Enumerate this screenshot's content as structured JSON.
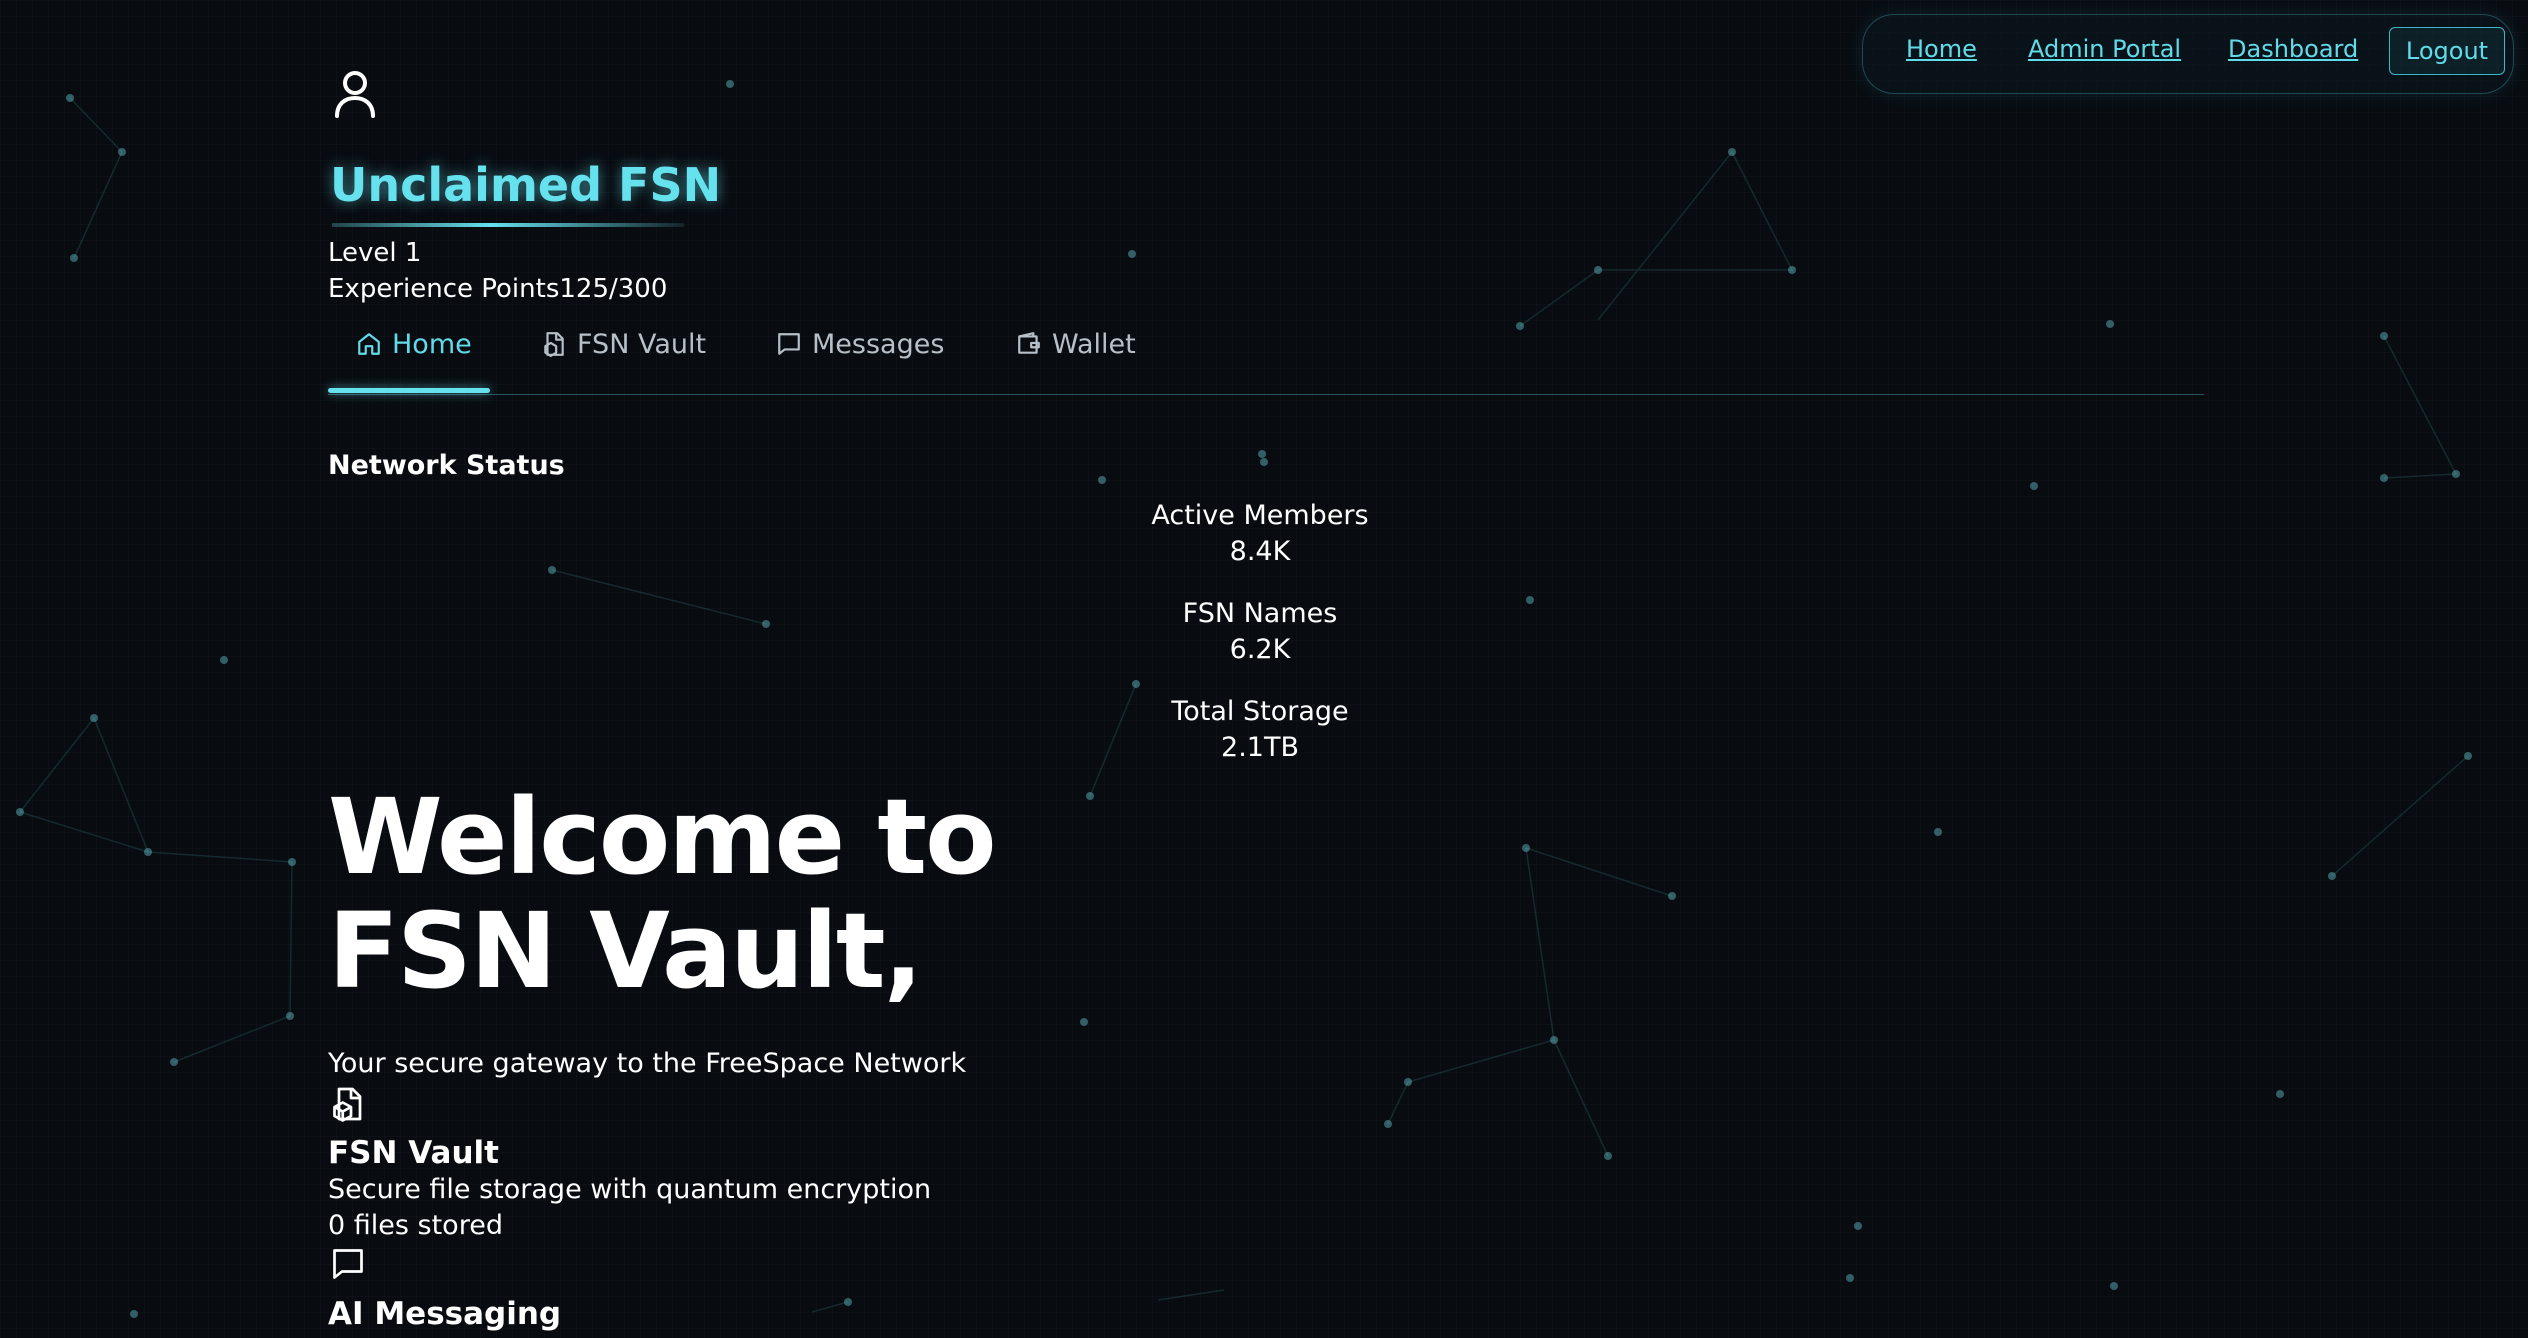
{
  "topnav": {
    "home": "Home",
    "admin_portal": "Admin Portal",
    "dashboard": "Dashboard",
    "logout": "Logout"
  },
  "profile": {
    "avatar_icon": "user-icon",
    "name": "Unclaimed FSN",
    "level": "Level 1",
    "xp": "Experience Points125/300"
  },
  "tabs": [
    {
      "label": "Home",
      "icon": "home-icon",
      "active": true
    },
    {
      "label": "FSN Vault",
      "icon": "vault-icon",
      "active": false
    },
    {
      "label": "Messages",
      "icon": "message-icon",
      "active": false
    },
    {
      "label": "Wallet",
      "icon": "wallet-icon",
      "active": false
    }
  ],
  "network_status": {
    "heading": "Network Status",
    "stats": [
      {
        "label": "Active Members",
        "value": "8.4K"
      },
      {
        "label": "FSN Names",
        "value": "6.2K"
      },
      {
        "label": "Total Storage",
        "value": "2.1TB"
      }
    ]
  },
  "welcome": {
    "headline": "Welcome to FSN Vault,",
    "tagline": "Your secure gateway to the FreeSpace Network"
  },
  "features": [
    {
      "icon": "vault-icon",
      "title": "FSN Vault",
      "description": "Secure file storage with quantum encryption",
      "meta": "0 files stored"
    },
    {
      "icon": "message-icon",
      "title": "AI Messaging"
    }
  ],
  "colors": {
    "accent": "#66e1ee",
    "background": "#080c11",
    "text": "#ffffff",
    "muted": "#b7c0c8"
  }
}
